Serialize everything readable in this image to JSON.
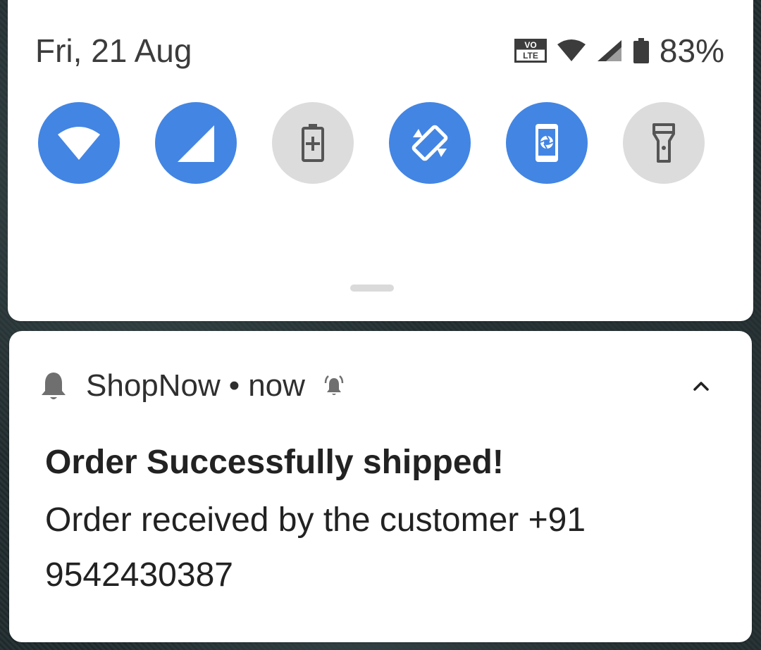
{
  "status_bar": {
    "date": "Fri, 21 Aug",
    "volte_label_top": "VO",
    "volte_label_bottom": "LTE",
    "battery_percent": "83%"
  },
  "quick_settings": {
    "tiles": [
      {
        "name": "wifi",
        "icon": "wifi-icon",
        "state": "on"
      },
      {
        "name": "mobile-data",
        "icon": "cellular-signal-icon",
        "state": "on"
      },
      {
        "name": "battery-saver",
        "icon": "battery-saver-icon",
        "state": "off"
      },
      {
        "name": "auto-rotate",
        "icon": "auto-rotate-icon",
        "state": "on"
      },
      {
        "name": "screen-capture",
        "icon": "phone-shutter-icon",
        "state": "on"
      },
      {
        "name": "flashlight",
        "icon": "flashlight-icon",
        "state": "off"
      }
    ],
    "colors": {
      "tile_on": "#4385e3",
      "tile_off": "#dcdcdc"
    }
  },
  "notification": {
    "app_icon": "bell-icon",
    "app_name": "ShopNow",
    "separator": "•",
    "time": "now",
    "alert_icon": "alerting-bell-icon",
    "expand_icon": "chevron-up-icon",
    "title": "Order Successfully shipped!",
    "body": "Order received by the customer +91 9542430387"
  }
}
